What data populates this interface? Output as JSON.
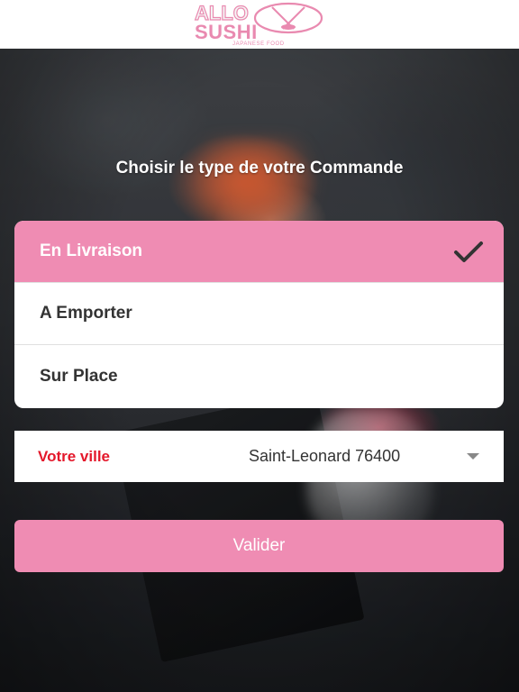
{
  "header": {
    "logo": {
      "line1": "ALLO",
      "line2": "SUSHI",
      "tagline": "JAPANESE FOOD"
    }
  },
  "main": {
    "title": "Choisir le type de votre Commande",
    "order_types": [
      {
        "label": "En Livraison",
        "selected": true
      },
      {
        "label": "A Emporter",
        "selected": false
      },
      {
        "label": "Sur Place",
        "selected": false
      }
    ],
    "city": {
      "label": "Votre ville",
      "value": "Saint-Leonard 76400"
    },
    "validate_label": "Valider"
  },
  "colors": {
    "accent": "#ef8cb3",
    "city_label": "#e4182b"
  },
  "icons": [
    "chopsticks-emblem-icon",
    "checkmark-icon",
    "dropdown-caret-icon"
  ]
}
